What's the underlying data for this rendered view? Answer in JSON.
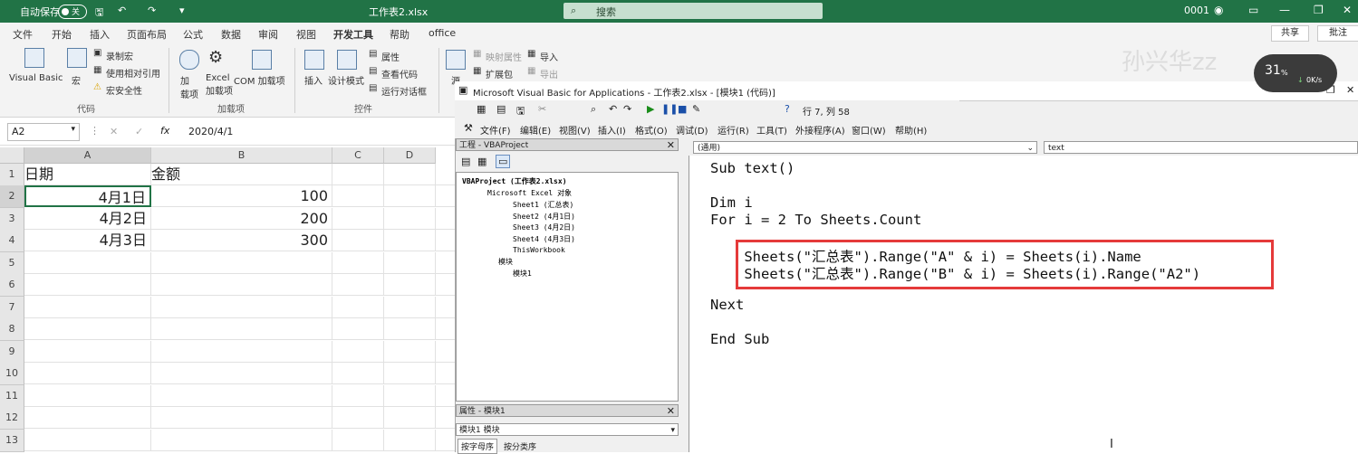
{
  "excel": {
    "autosave_label": "自动保存",
    "autosave_state": "关",
    "file_title": "工作表2.xlsx",
    "search_placeholder": "搜索",
    "user": "0001",
    "ribbon_tabs": [
      "文件",
      "开始",
      "插入",
      "页面布局",
      "公式",
      "数据",
      "审阅",
      "视图",
      "开发工具",
      "帮助",
      "office"
    ],
    "active_tab": "开发工具",
    "share": "共享",
    "comment": "批注",
    "ribbon": {
      "code_group": "代码",
      "visual_basic": "Visual Basic",
      "macro": "宏",
      "record_macro": "录制宏",
      "relative_ref": "使用相对引用",
      "macro_security": "宏安全性",
      "addins_group": "加载项",
      "addins": "加\n载项",
      "excel_addins": "Excel\n加载项",
      "com_addins": "COM 加载项",
      "insert": "插入",
      "design_mode": "设计模式",
      "controls_group": "控件",
      "properties": "属性",
      "view_code": "查看代码",
      "run_dialog": "运行对话框",
      "source": "源",
      "map_props": "映射属性",
      "import": "导入",
      "expansion_pack": "扩展包",
      "export": "导出"
    },
    "name_box": "A2",
    "formula_value": "2020/4/1",
    "columns": [
      "A",
      "B",
      "C",
      "D"
    ],
    "rows": [
      "1",
      "2",
      "3",
      "4",
      "5",
      "6",
      "7",
      "8",
      "9",
      "10",
      "11",
      "12",
      "13"
    ],
    "cells": {
      "a1": "日期",
      "b1": "金额",
      "a2": "4月1日",
      "b2": "100",
      "a3": "4月2日",
      "b3": "200",
      "a4": "4月3日",
      "b4": "300"
    }
  },
  "vbe": {
    "title": "Microsoft Visual Basic for Applications - 工作表2.xlsx - [模块1 (代码)]",
    "cursor_pos": "行 7, 列 58",
    "menu": [
      "文件(F)",
      "编辑(E)",
      "视图(V)",
      "插入(I)",
      "格式(O)",
      "调试(D)",
      "运行(R)",
      "工具(T)",
      "外接程序(A)",
      "窗口(W)",
      "帮助(H)"
    ],
    "project_pane_title": "工程 - VBAProject",
    "tree": {
      "root": "VBAProject (工作表2.xlsx)",
      "excel_objects": "Microsoft Excel 对象",
      "sheet1": "Sheet1 (汇总表)",
      "sheet2": "Sheet2 (4月1日)",
      "sheet3": "Sheet3 (4月2日)",
      "sheet4": "Sheet4 (4月3日)",
      "thisworkbook": "ThisWorkbook",
      "modules": "模块",
      "module1": "模块1"
    },
    "props_pane_title": "属性 - 模块1",
    "props_object": "模块1 模块",
    "props_tab_alpha": "按字母序",
    "props_tab_cat": "按分类序",
    "object_dropdown": "(通用)",
    "proc_dropdown": "text",
    "code_lines": [
      "Sub text()",
      "",
      "Dim i",
      "For i = 2 To Sheets.Count",
      "",
      "    Sheets(\"汇总表\").Range(\"A\" & i) = Sheets(i).Name",
      "    Sheets(\"汇总表\").Range(\"B\" & i) = Sheets(i).Range(\"A2\")",
      "",
      "Next",
      "",
      "End Sub"
    ]
  },
  "overlay": {
    "watermark": "孙兴华zz",
    "percent": "31",
    "percent_unit": "%",
    "speed": "0K/s"
  },
  "colors": {
    "excel_green": "#217346",
    "highlight_red": "#e53a3a"
  }
}
